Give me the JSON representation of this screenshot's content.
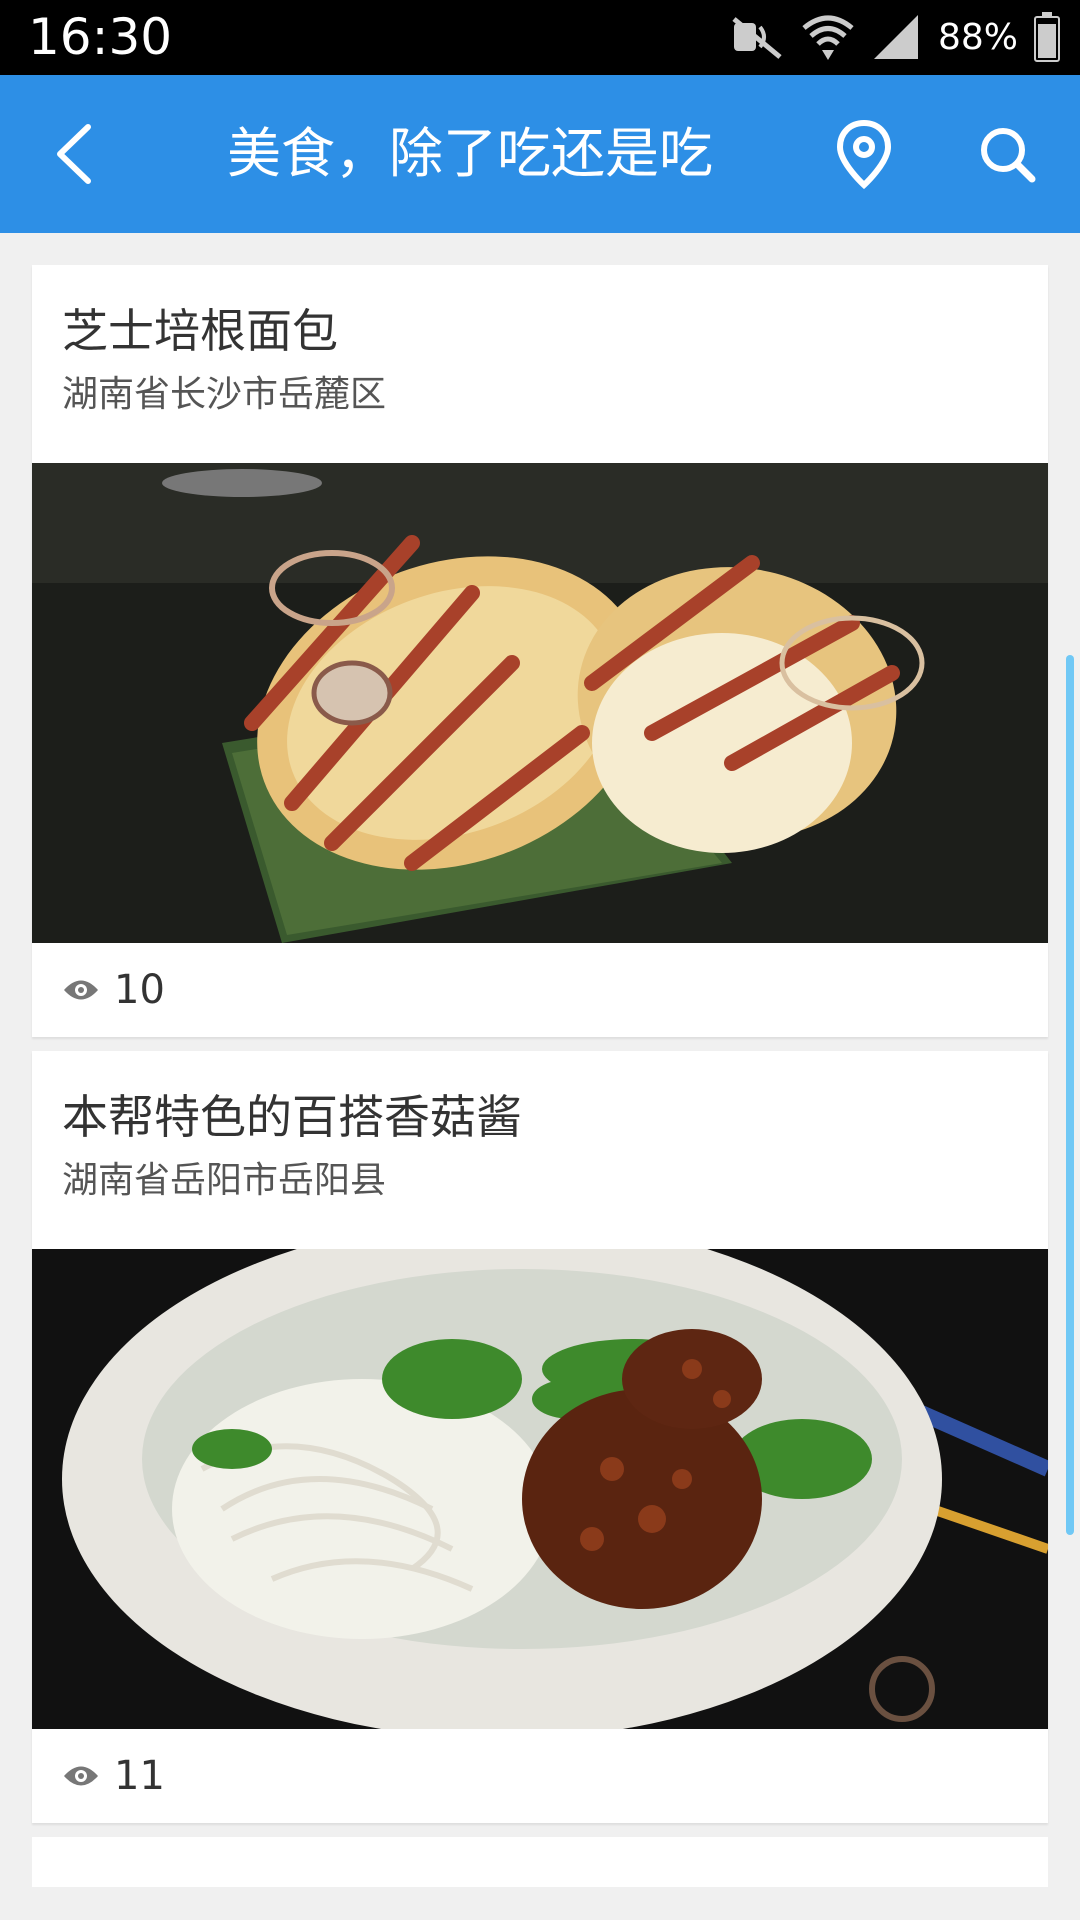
{
  "status_bar": {
    "time": "16:30",
    "battery": "88%"
  },
  "header": {
    "title": "美食，除了吃还是吃"
  },
  "posts": [
    {
      "title": "芝士培根面包",
      "location": "湖南省长沙市岳麓区",
      "views": "10"
    },
    {
      "title": "本帮特色的百搭香菇酱",
      "location": "湖南省岳阳市岳阳县",
      "views": "11"
    }
  ],
  "colors": {
    "status_bar": "#000000",
    "app_bar": "#2d8fe6",
    "background": "#f0f0f0",
    "scrollbar": "#70c8f5"
  }
}
